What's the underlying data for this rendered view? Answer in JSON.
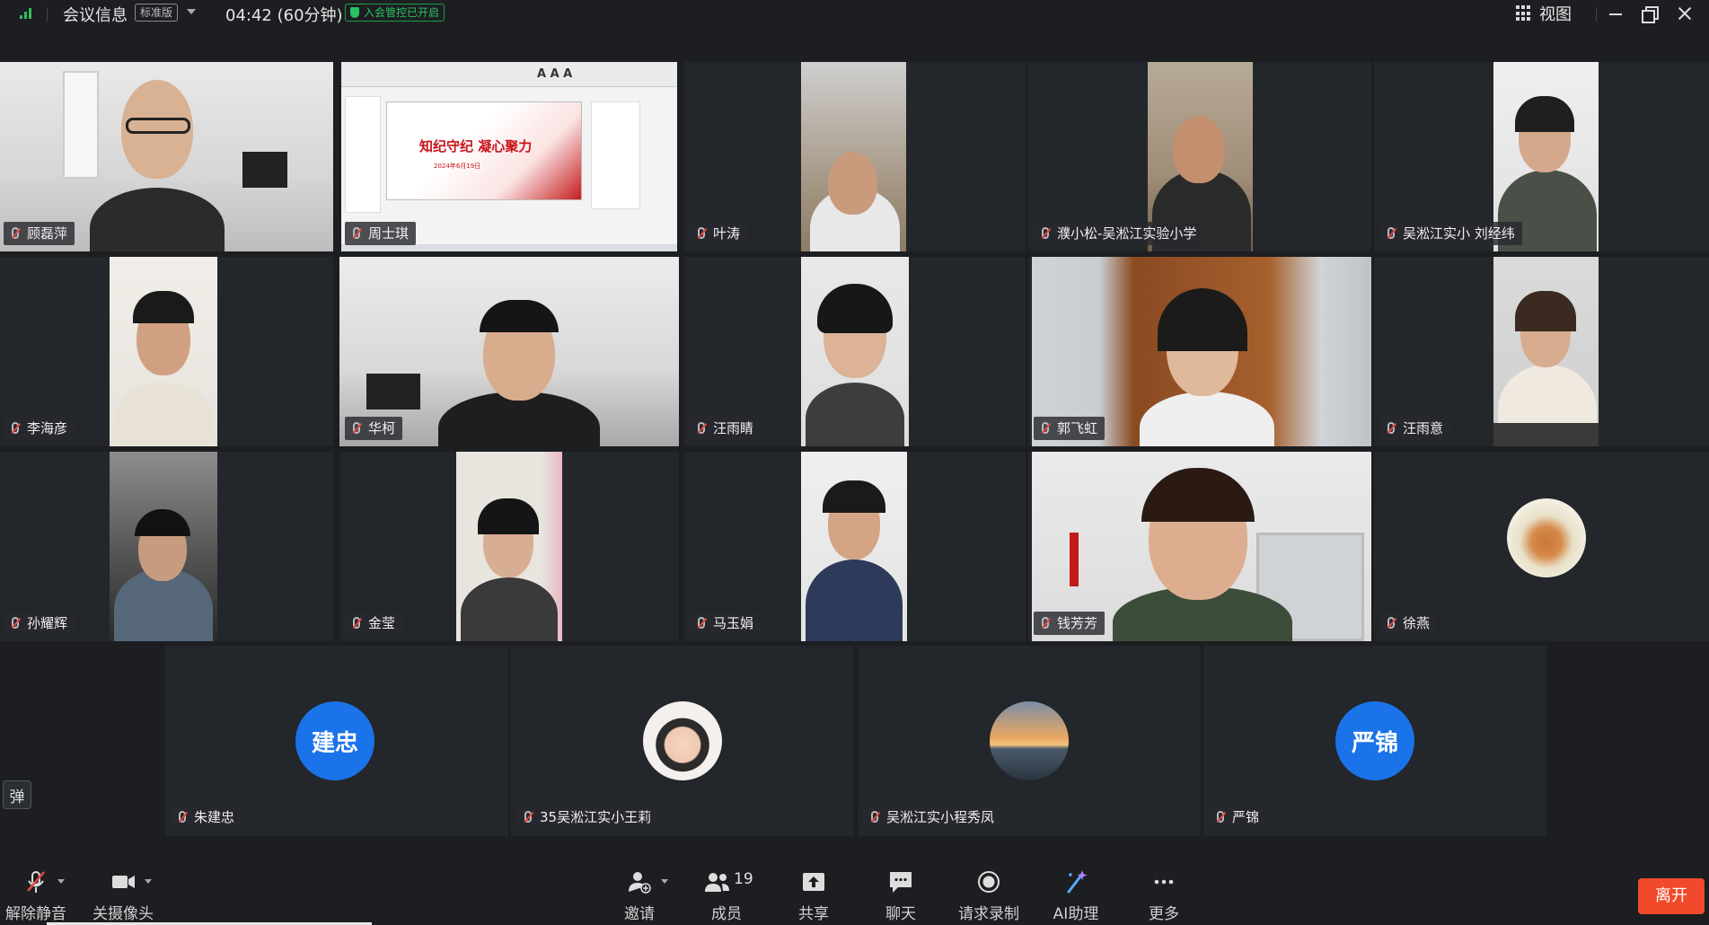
{
  "topbar": {
    "meeting_info": "会议信息",
    "edition": "标准版",
    "duration": "04:42 (60分钟)",
    "control_status": "入会管控已开启",
    "view_label": "视图"
  },
  "participants": [
    {
      "name": "顾磊萍"
    },
    {
      "name": "周士琪"
    },
    {
      "name": "叶涛"
    },
    {
      "name": "濮小松-吴淞江实验小学"
    },
    {
      "name": "吴淞江实小  刘经纬"
    },
    {
      "name": "李海彦"
    },
    {
      "name": "华柯"
    },
    {
      "name": "汪雨睛"
    },
    {
      "name": "郭飞虹"
    },
    {
      "name": "汪雨意"
    },
    {
      "name": "孙耀辉"
    },
    {
      "name": "金莹"
    },
    {
      "name": "马玉娟"
    },
    {
      "name": "钱芳芳"
    },
    {
      "name": "徐燕"
    },
    {
      "name": "朱建忠",
      "avatar_text": "建忠"
    },
    {
      "name": "35吴淞江实小王莉"
    },
    {
      "name": "吴淞江实小程秀凤"
    },
    {
      "name": "严锦",
      "avatar_text": "严锦"
    }
  ],
  "slide": {
    "title": "知纪守纪  凝心聚力",
    "subtitle": "2024年6月19日",
    "font_tools": "A A A"
  },
  "danmaku_label": "弹",
  "toolbar": {
    "unmute": "解除静音",
    "camera_off": "关摄像头",
    "invite": "邀请",
    "members": "成员",
    "member_count": "19",
    "share": "共享",
    "chat": "聊天",
    "record": "请求录制",
    "ai": "AI助理",
    "more": "更多",
    "leave": "离开"
  },
  "colors": {
    "accent_blue": "#1a73e8",
    "leave_red": "#f04a2a",
    "status_green": "#29c262",
    "background": "#1c1e21"
  }
}
